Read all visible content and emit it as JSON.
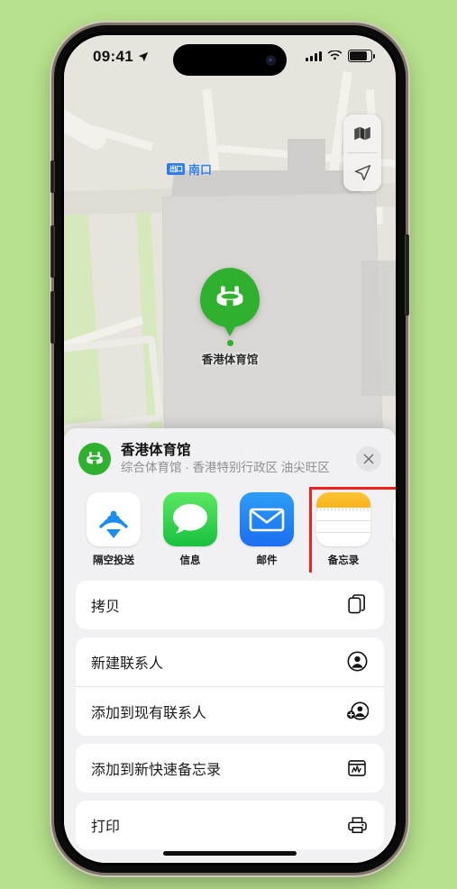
{
  "status_bar": {
    "time": "09:41",
    "location_arrow_icon": "location-arrow-icon",
    "cellular_icon": "signal-bars-icon",
    "wifi_icon": "wifi-icon",
    "battery_icon": "battery-icon"
  },
  "map": {
    "transit_badge": "出口",
    "transit_label": "南口",
    "pin_label": "香港体育馆",
    "pin_color": "#2fb12f",
    "controls": [
      {
        "name": "map-layers-icon"
      },
      {
        "name": "locate-me-icon"
      }
    ]
  },
  "sheet": {
    "title": "香港体育馆",
    "subtitle": "综合体育馆 · 香港特别行政区 油尖旺区",
    "close_label": "✕",
    "highlight_color": "#f02020",
    "apps": [
      {
        "label": "隔空投送",
        "icon": "airdrop-icon",
        "highlighted": false
      },
      {
        "label": "信息",
        "icon": "messages-icon",
        "highlighted": false
      },
      {
        "label": "邮件",
        "icon": "mail-icon",
        "highlighted": false
      },
      {
        "label": "备忘录",
        "icon": "notes-icon",
        "highlighted": true
      },
      {
        "label": "提",
        "icon": "reminders-icon",
        "highlighted": false
      }
    ],
    "groups": [
      {
        "rows": [
          {
            "label": "拷贝",
            "icon": "copy-icon"
          }
        ]
      },
      {
        "rows": [
          {
            "label": "新建联系人",
            "icon": "new-contact-icon"
          },
          {
            "label": "添加到现有联系人",
            "icon": "add-to-contact-icon"
          }
        ]
      },
      {
        "rows": [
          {
            "label": "添加到新快速备忘录",
            "icon": "quick-note-icon"
          }
        ]
      },
      {
        "rows": [
          {
            "label": "打印",
            "icon": "printer-icon"
          }
        ]
      }
    ]
  }
}
